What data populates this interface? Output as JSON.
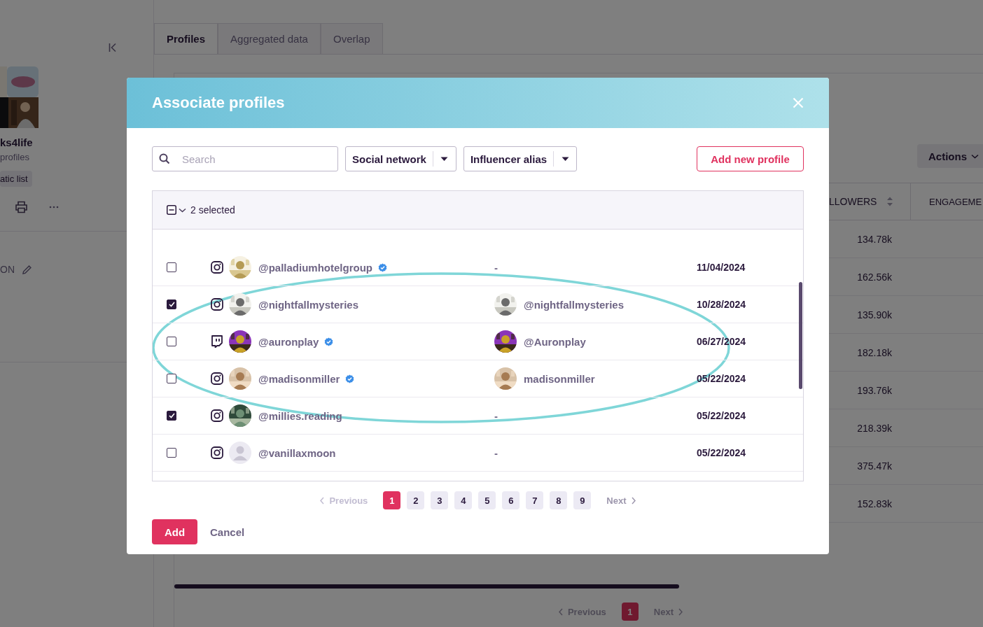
{
  "background": {
    "sidebar": {
      "list_name": "ks4life",
      "list_meta": "profiles",
      "list_type": "atic list",
      "section_label": "ON"
    },
    "tabs": [
      {
        "label": "Profiles",
        "selected": true
      },
      {
        "label": "Aggregated data",
        "selected": false
      },
      {
        "label": "Overlap",
        "selected": false
      }
    ],
    "actions_button": "Actions",
    "table": {
      "columns": [
        "LLOWERS",
        "ENGAGEME"
      ],
      "rows": [
        {
          "followers": "134.78k"
        },
        {
          "followers": "162.56k"
        },
        {
          "followers": "135.90k"
        },
        {
          "followers": "182.18k"
        },
        {
          "followers": "193.76k"
        },
        {
          "followers": "218.39k"
        },
        {
          "followers": "375.47k"
        },
        {
          "followers": "152.83k"
        }
      ]
    },
    "pagination": {
      "previous": "Previous",
      "pages": [
        {
          "label": "1",
          "selected": true
        }
      ],
      "next": "Next"
    }
  },
  "modal": {
    "title": "Associate profiles",
    "search": {
      "placeholder": "Search"
    },
    "filters": [
      "Social network",
      "Influencer alias"
    ],
    "add_profile_button": "Add new profile",
    "select_all": {
      "indeterminate": true
    },
    "selection_label": "2 selected",
    "rows": [
      {
        "checked": false,
        "network": {
          "kind": "instagram"
        },
        "handle": "@palladiumhotelgroup",
        "verified": true,
        "alias": {
          "text": "-"
        },
        "date": "11/04/2024"
      },
      {
        "checked": true,
        "network": {
          "kind": "instagram"
        },
        "handle": "@nightfallmysteries",
        "verified": false,
        "alias": {
          "text": "@nightfallmysteries"
        },
        "date": "10/28/2024"
      },
      {
        "checked": false,
        "network": {
          "kind": "twitch"
        },
        "handle": "@auronplay",
        "verified": true,
        "alias": {
          "text": "@Auronplay"
        },
        "date": "06/27/2024"
      },
      {
        "checked": false,
        "network": {
          "kind": "instagram"
        },
        "handle": "@madisonmiller",
        "verified": true,
        "alias": {
          "text": "madisonmiller"
        },
        "date": "05/22/2024"
      },
      {
        "checked": true,
        "network": {
          "kind": "instagram"
        },
        "handle": "@millies.reading",
        "verified": false,
        "alias": {
          "text": "-"
        },
        "date": "05/22/2024"
      },
      {
        "checked": false,
        "network": {
          "kind": "instagram"
        },
        "avatar": {
          "kind": "placeholder"
        },
        "handle": "@vanillaxmoon",
        "verified": false,
        "alias": {
          "text": "-"
        },
        "date": "05/22/2024"
      }
    ],
    "pagination": {
      "previous": {
        "label": "Previous",
        "disabled": true
      },
      "pages": [
        {
          "label": "1",
          "selected": true
        },
        {
          "label": "2",
          "selected": false
        },
        {
          "label": "3",
          "selected": false
        },
        {
          "label": "4",
          "selected": false
        },
        {
          "label": "5",
          "selected": false
        },
        {
          "label": "6",
          "selected": false
        },
        {
          "label": "7",
          "selected": false
        },
        {
          "label": "8",
          "selected": false
        },
        {
          "label": "9",
          "selected": false
        }
      ],
      "next": {
        "label": "Next",
        "disabled": false
      }
    },
    "add_button": "Add",
    "cancel_button": "Cancel",
    "annotation": {
      "kind": "ellipse"
    }
  }
}
